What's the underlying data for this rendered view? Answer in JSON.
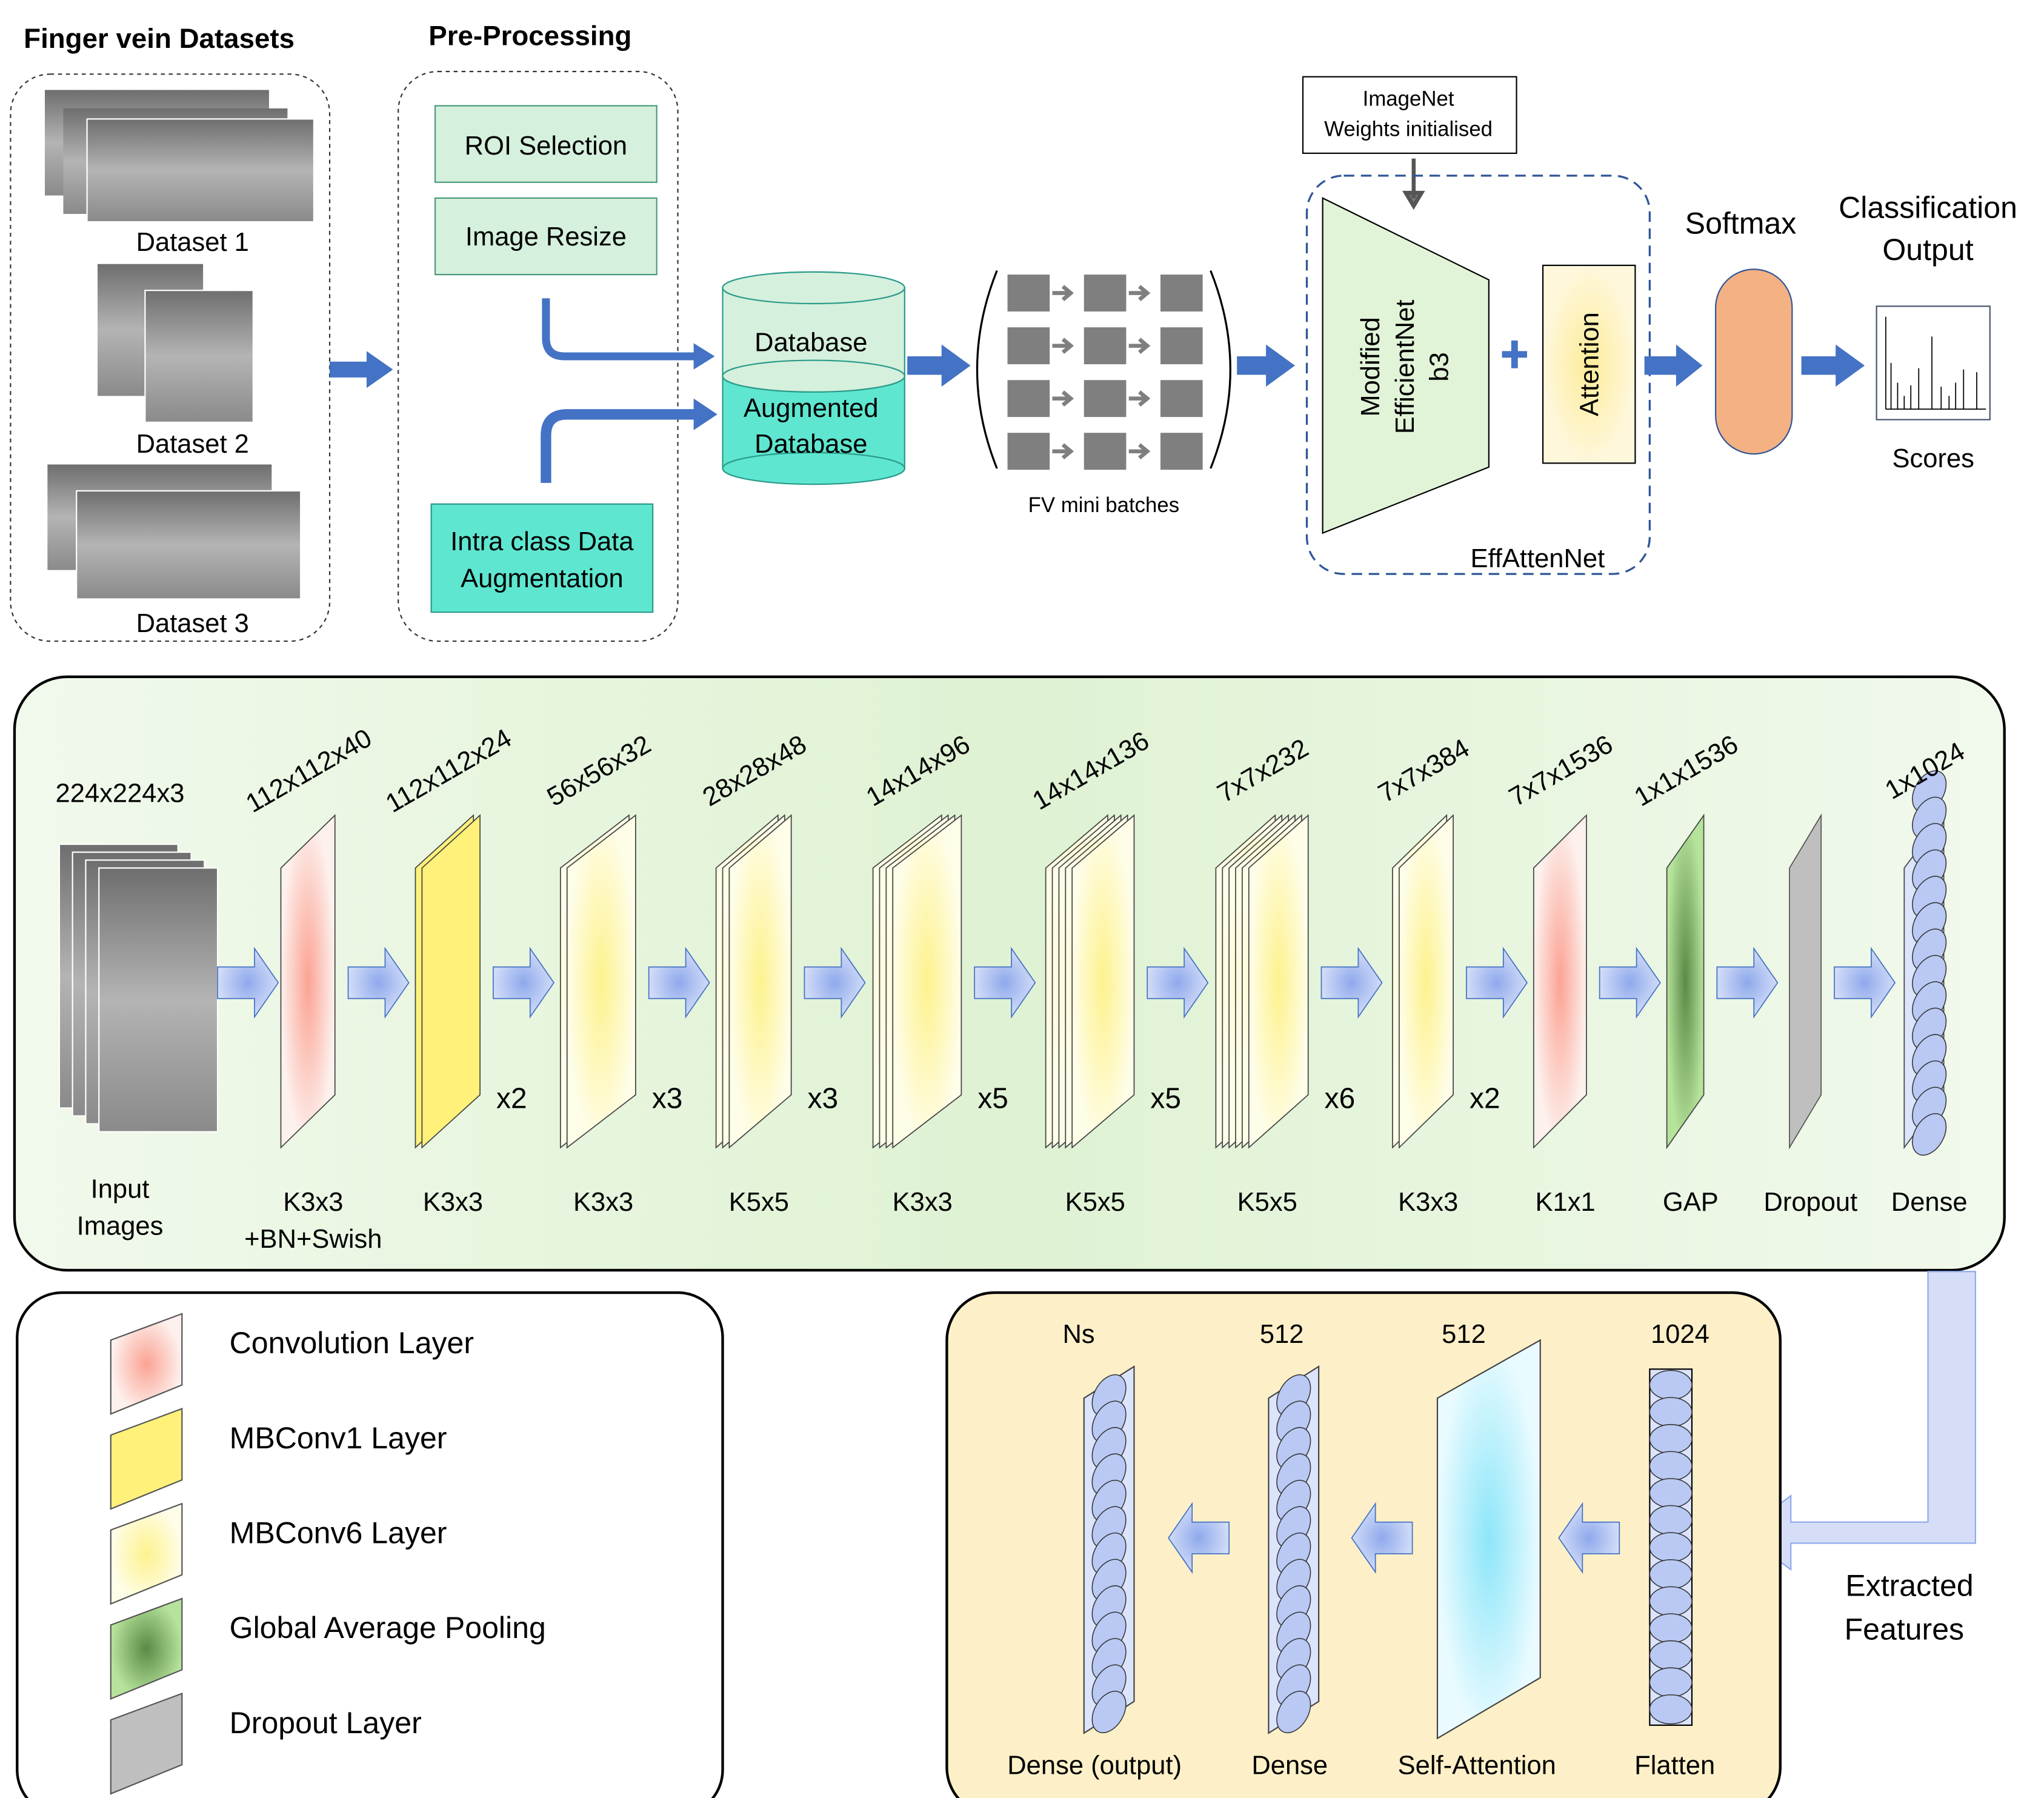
{
  "top": {
    "datasets_title": "Finger vein Datasets",
    "datasets": [
      "Dataset 1",
      "Dataset 2",
      "Dataset 3"
    ],
    "preprocessing_title": "Pre-Processing",
    "roi": "ROI Selection",
    "resize": "Image Resize",
    "augment": [
      "Intra class Data",
      "Augmentation"
    ],
    "database": "Database",
    "augmented_db": [
      "Augmented",
      "Database"
    ],
    "mini_batches": "FV mini batches",
    "imagenet": [
      "ImageNet",
      "Weights initialised"
    ],
    "backbone": [
      "Modified",
      "EfficientNet",
      "b3"
    ],
    "attention": "Attention",
    "effattennet": "EffAttenNet",
    "softmax": "Softmax",
    "classification": [
      "Classification",
      "Output"
    ],
    "scores": "Scores"
  },
  "layers": [
    {
      "dim": "224x224x3",
      "label": [
        "Input",
        "Images"
      ],
      "kind": "input"
    },
    {
      "dim": "112x112x40",
      "label": [
        "K3x3",
        "+BN+Swish"
      ],
      "kind": "conv"
    },
    {
      "dim": "112x112x24",
      "label": [
        "K3x3"
      ],
      "kind": "mbconv1",
      "rep": "x2"
    },
    {
      "dim": "56x56x32",
      "label": [
        "K3x3"
      ],
      "kind": "mbconv6",
      "rep": "x3"
    },
    {
      "dim": "28x28x48",
      "label": [
        "K5x5"
      ],
      "kind": "mbconv6",
      "rep": "x3"
    },
    {
      "dim": "14x14x96",
      "label": [
        "K3x3"
      ],
      "kind": "mbconv6",
      "rep": "x5"
    },
    {
      "dim": "14x14x136",
      "label": [
        "K5x5"
      ],
      "kind": "mbconv6",
      "rep": "x5"
    },
    {
      "dim": "7x7x232",
      "label": [
        "K5x5"
      ],
      "kind": "mbconv6",
      "rep": "x6"
    },
    {
      "dim": "7x7x384",
      "label": [
        "K3x3"
      ],
      "kind": "mbconv6",
      "rep": "x2"
    },
    {
      "dim": "7x7x1536",
      "label": [
        "K1x1"
      ],
      "kind": "conv"
    },
    {
      "dim": "1x1x1536",
      "label": [
        "GAP"
      ],
      "kind": "gap"
    },
    {
      "dim": "",
      "label": [
        "Dropout"
      ],
      "kind": "dropout"
    },
    {
      "dim": "1x1024",
      "label": [
        "Dense"
      ],
      "kind": "dense"
    }
  ],
  "legend": [
    "Convolution Layer",
    "MBConv1 Layer",
    "MBConv6 Layer",
    "Global Average Pooling",
    "Dropout Layer"
  ],
  "head": {
    "extracted": [
      "Extracted",
      "Features"
    ],
    "layers": [
      {
        "dim": "Ns",
        "label": "Dense (output)"
      },
      {
        "dim": "512",
        "label": "Dense"
      },
      {
        "dim": "512",
        "label": "Self-Attention"
      },
      {
        "dim": "1024",
        "label": "Flatten"
      }
    ]
  },
  "colors": {
    "arrow": "#4472c4",
    "green_panel": "#e2f0d9",
    "yellow_panel": "#fdf0c8",
    "teal": "#5ee6d0",
    "mint": "#d5f0dc",
    "softmax": "#f4b183"
  }
}
